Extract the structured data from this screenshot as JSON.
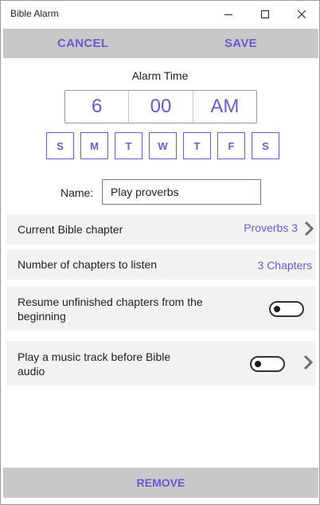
{
  "window": {
    "title": "Bible Alarm"
  },
  "command_bar": {
    "cancel_label": "CANCEL",
    "save_label": "SAVE"
  },
  "alarm": {
    "label": "Alarm Time",
    "hour": "6",
    "minute": "00",
    "period": "AM"
  },
  "days": [
    "S",
    "M",
    "T",
    "W",
    "T",
    "F",
    "S"
  ],
  "name": {
    "label": "Name:",
    "value": "Play proverbs"
  },
  "settings": {
    "chapter": {
      "label": "Current Bible chapter",
      "value": "Proverbs 3"
    },
    "count": {
      "label": "Number of chapters to listen",
      "value": "3 Chapters"
    },
    "resume": {
      "label": "Resume unfinished chapters from the beginning",
      "enabled": false
    },
    "music": {
      "label": "Play a music track before Bible audio",
      "enabled": false
    }
  },
  "bottom_bar": {
    "remove_label": "REMOVE"
  },
  "colors": {
    "accent": "#6a5acd",
    "bar_background": "#c8c8c8",
    "row_background": "#f2f2f2"
  }
}
